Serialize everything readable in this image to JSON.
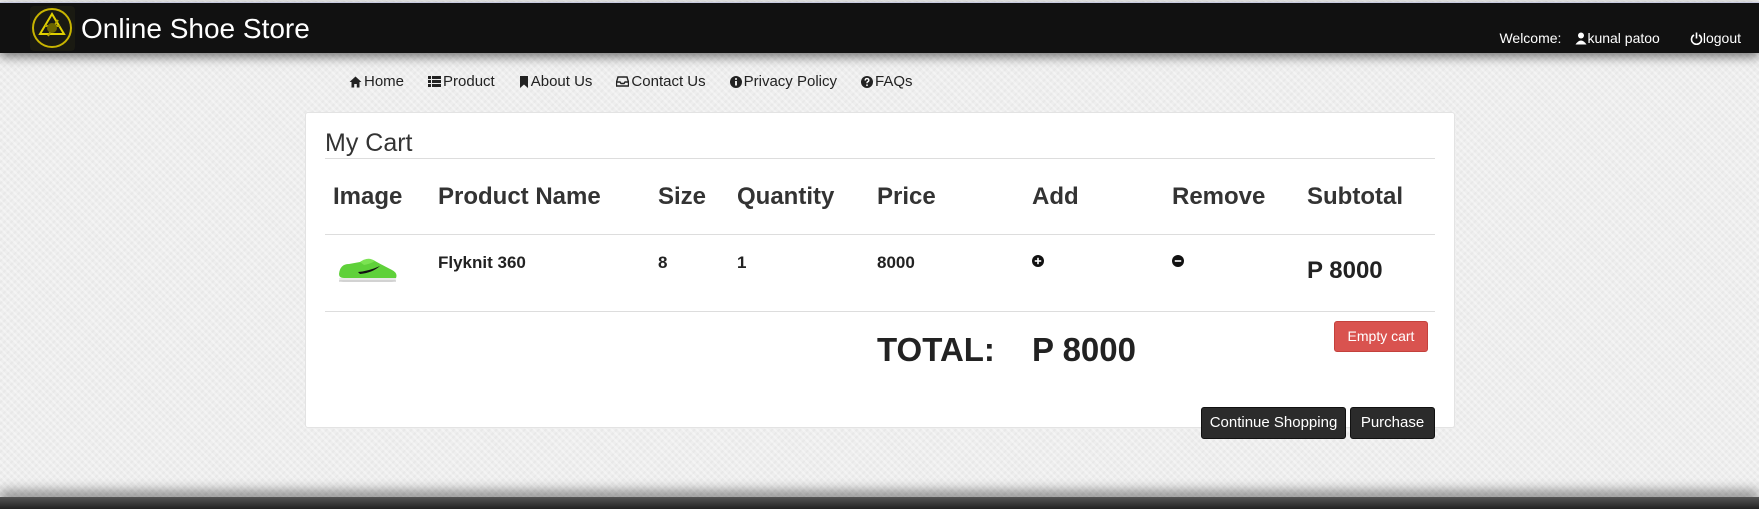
{
  "header": {
    "brand": "Online Shoe Store",
    "welcome_label": "Welcome:",
    "username": "kunal patoo",
    "logout_label": "logout"
  },
  "nav": {
    "items": [
      {
        "label": "Home",
        "icon": "home-icon"
      },
      {
        "label": "Product",
        "icon": "list-icon"
      },
      {
        "label": "About Us",
        "icon": "bookmark-icon"
      },
      {
        "label": "Contact Us",
        "icon": "inbox-icon"
      },
      {
        "label": "Privacy Policy",
        "icon": "info-icon"
      },
      {
        "label": "FAQs",
        "icon": "question-icon"
      }
    ]
  },
  "cart": {
    "title": "My Cart",
    "columns": [
      "Image",
      "Product Name",
      "Size",
      "Quantity",
      "Price",
      "Add",
      "Remove",
      "Subtotal"
    ],
    "rows": [
      {
        "image": "green-shoe-image",
        "product_name": "Flyknit 360",
        "size": "8",
        "quantity": "1",
        "price": "8000",
        "add_icon": "plus-circle-icon",
        "remove_icon": "minus-circle-icon",
        "subtotal": "P 8000"
      }
    ],
    "total_label": "TOTAL:",
    "total_value": "P 8000",
    "empty_cart_label": "Empty cart",
    "continue_label": "Continue Shopping",
    "purchase_label": "Purchase"
  },
  "colors": {
    "topbar": "#111111",
    "danger": "#d9534f",
    "dark_button": "#2b2b2b"
  }
}
